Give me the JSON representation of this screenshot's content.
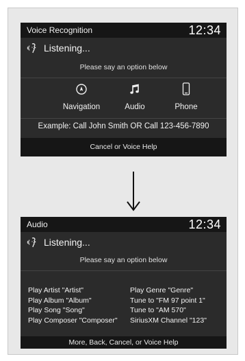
{
  "screen1": {
    "title": "Voice Recognition",
    "clock": "12:34",
    "status": "Listening...",
    "prompt": "Please say an option below",
    "options": [
      {
        "label": "Navigation",
        "icon": "navigation-icon"
      },
      {
        "label": "Audio",
        "icon": "music-note-icon"
      },
      {
        "label": "Phone",
        "icon": "phone-icon"
      }
    ],
    "example": "Example: Call John Smith OR Call 123-456-7890",
    "footer": "Cancel or Voice Help"
  },
  "arrow": {
    "icon": "arrow-down-icon"
  },
  "screen2": {
    "title": "Audio",
    "clock": "12:34",
    "status": "Listening...",
    "prompt": "Please say an option below",
    "commands_left": [
      "Play Artist \"Artist\"",
      "Play Album \"Album\"",
      "Play Song \"Song\"",
      "Play Composer \"Composer\""
    ],
    "commands_right": [
      "Play Genre \"Genre\"",
      "Tune to \"FM 97 point 1\"",
      "Tune to \"AM 570\"",
      "SiriusXM Channel \"123\""
    ],
    "footer": "More, Back, Cancel, or Voice Help"
  },
  "colors": {
    "screen_bg": "#2b2b2b",
    "bar_bg": "#161616",
    "text": "#f2f2f2",
    "frame_bg": "#e8e8e8"
  }
}
